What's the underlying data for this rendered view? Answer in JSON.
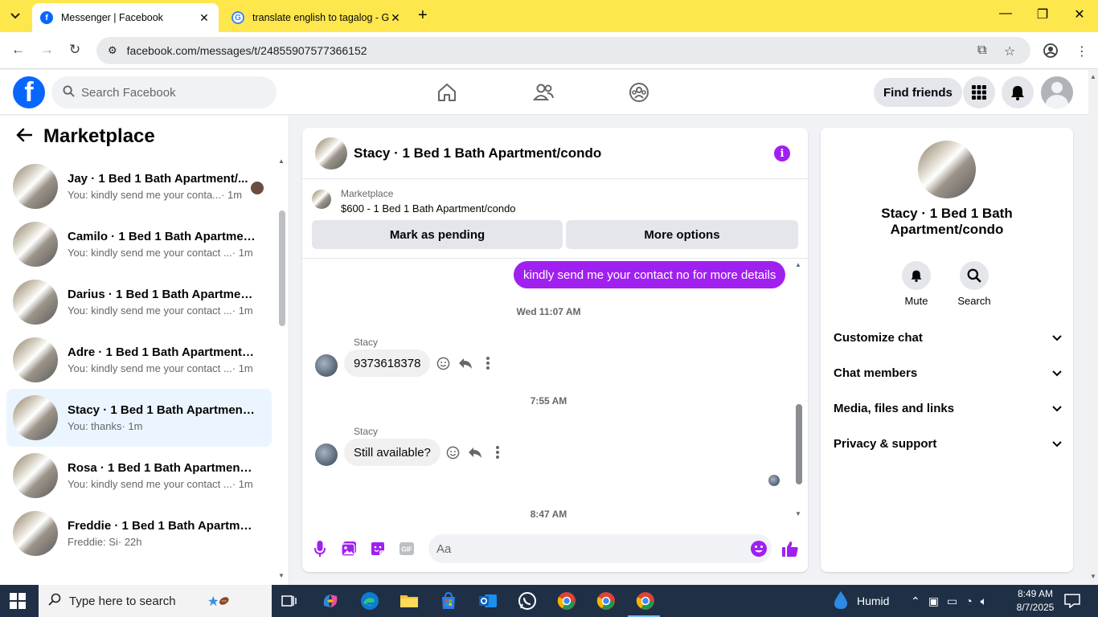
{
  "browser": {
    "tabs": [
      {
        "title": "Messenger | Facebook",
        "active": true
      },
      {
        "title": "translate english to tagalog - G",
        "active": false
      }
    ],
    "url": "facebook.com/messages/t/24855907577366152"
  },
  "header": {
    "search_placeholder": "Search Facebook",
    "find_friends": "Find friends"
  },
  "sidebar": {
    "title": "Marketplace",
    "conversations": [
      {
        "name": "Jay · 1 Bed 1 Bath Apartment/...",
        "preview": "You: kindly send me your conta...",
        "time": "· 1m",
        "selected": false
      },
      {
        "name": "Camilo · 1 Bed 1 Bath Apartment...",
        "preview": "You: kindly send me your contact ...",
        "time": "· 1m",
        "selected": false
      },
      {
        "name": "Darius · 1 Bed 1 Bath Apartment/...",
        "preview": "You: kindly send me your contact ...",
        "time": "· 1m",
        "selected": false
      },
      {
        "name": "Adre · 1 Bed 1 Bath Apartment/c...",
        "preview": "You: kindly send me your contact ...",
        "time": "· 1m",
        "selected": false
      },
      {
        "name": "Stacy · 1 Bed 1 Bath Apartment/c...",
        "preview": "You: thanks",
        "time": "· 1m",
        "selected": true
      },
      {
        "name": "Rosa · 1 Bed 1 Bath Apartment/c...",
        "preview": "You: kindly send me your contact ...",
        "time": "· 1m",
        "selected": false
      },
      {
        "name": "Freddie · 1 Bed 1 Bath Apartmen...",
        "preview": "Freddie: Si",
        "time": "· 22h",
        "selected": false
      }
    ]
  },
  "chat": {
    "title": "Stacy · 1 Bed 1 Bath Apartment/condo",
    "listing": {
      "category": "Marketplace",
      "title": "$600 - 1 Bed 1 Bath Apartment/condo",
      "mark_pending": "Mark as pending",
      "more_options": "More options"
    },
    "outgoing_message": "kindly send me your contact no for more details",
    "timestamp1": "Wed 11:07 AM",
    "sender1": "Stacy",
    "message1": "9373618378",
    "timestamp2": "7:55 AM",
    "sender2": "Stacy",
    "message2": "Still available?",
    "timestamp3": "8:47 AM",
    "composer_placeholder": "Aa"
  },
  "details": {
    "name": "Stacy · 1 Bed 1 Bath Apartment/condo",
    "mute": "Mute",
    "search": "Search",
    "sections": [
      "Customize chat",
      "Chat members",
      "Media, files and links",
      "Privacy & support"
    ]
  },
  "taskbar": {
    "search_placeholder": "Type here to search",
    "weather": "Humid",
    "time": "8:49 AM",
    "date": "8/7/2025"
  },
  "colors": {
    "accent": "#a020f0",
    "facebook_blue": "#0866ff",
    "tab_bar": "#fde74c",
    "selected_conv": "#ebf5ff"
  }
}
